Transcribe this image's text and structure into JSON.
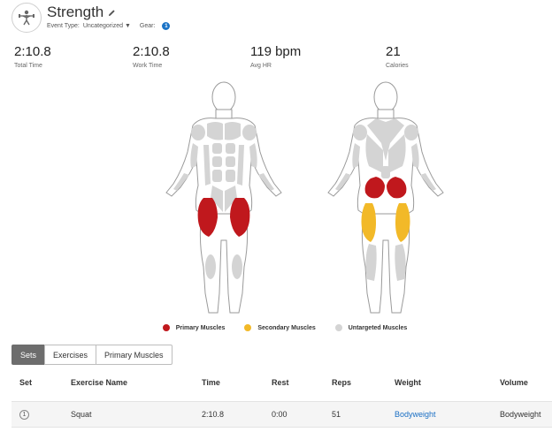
{
  "activity": {
    "icon": "strength-training-icon",
    "title": "Strength",
    "event_type_label": "Event Type:",
    "event_type_value": "Uncategorized",
    "gear_label": "Gear:",
    "gear_count": "1"
  },
  "stats": [
    {
      "value": "2:10.8",
      "label": "Total Time"
    },
    {
      "value": "2:10.8",
      "label": "Work Time"
    },
    {
      "value": "119 bpm",
      "label": "Avg HR"
    },
    {
      "value": "21",
      "label": "Calories"
    }
  ],
  "colors": {
    "primary": "#c0181d",
    "secondary": "#f2b928",
    "untargeted": "#d4d4d4",
    "accent": "#1a73c6"
  },
  "legend": {
    "primary": "Primary Muscles",
    "secondary": "Secondary Muscles",
    "untargeted": "Untargeted Muscles"
  },
  "tabs": [
    "Sets",
    "Exercises",
    "Primary Muscles"
  ],
  "table": {
    "headers": [
      "Set",
      "Exercise Name",
      "Time",
      "Rest",
      "Reps",
      "Weight",
      "Volume"
    ],
    "rows": [
      {
        "set": "1",
        "exercise": "Squat",
        "time": "2:10.8",
        "rest": "0:00",
        "reps": "51",
        "weight": "Bodyweight",
        "volume": "Bodyweight"
      }
    ]
  }
}
